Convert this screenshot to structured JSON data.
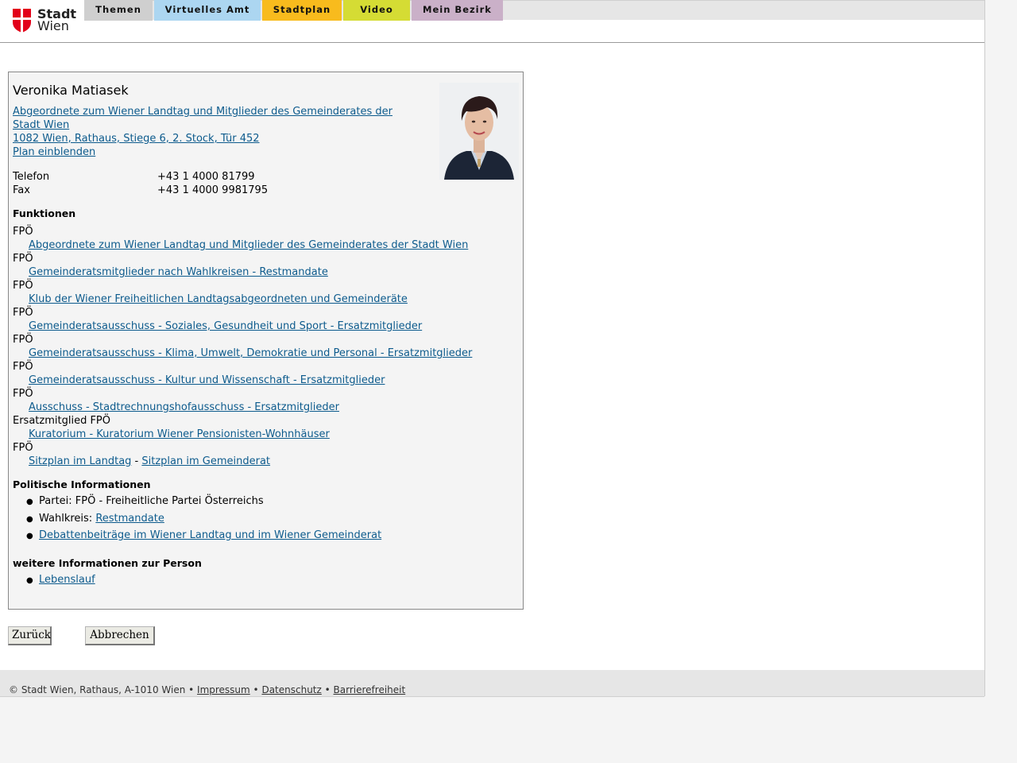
{
  "logo": {
    "line1": "Stadt",
    "line2": "Wien"
  },
  "nav": {
    "tabs": [
      {
        "label": "Themen",
        "color": "#cfcfcf"
      },
      {
        "label": "Virtuelles Amt",
        "color": "#acd6f1"
      },
      {
        "label": "Stadtplan",
        "color": "#f8bb1d"
      },
      {
        "label": "Video",
        "color": "#d5dc34"
      },
      {
        "label": "Mein Bezirk",
        "color": "#cab0c8"
      }
    ]
  },
  "person": {
    "name": "Veronika Matiasek",
    "role_line1": "Abgeordnete zum Wiener Landtag und Mitglieder des Gemeinderates der",
    "role_line2": "Stadt Wien ",
    "address": "1082 Wien, Rathaus, Stiege 6, 2. Stock, Tür 452",
    "plan_link": "Plan einblenden",
    "phone_label": "Telefon",
    "phone": "+43 1 4000 81799",
    "fax_label": "Fax",
    "fax": "+43 1 4000 9981795"
  },
  "functions": {
    "heading": "Funktionen",
    "items": [
      {
        "party": "FPÖ",
        "link": "Abgeordnete zum Wiener Landtag und Mitglieder des Gemeinderates der Stadt Wien"
      },
      {
        "party": "FPÖ",
        "link": "Gemeinderatsmitglieder nach Wahlkreisen - Restmandate"
      },
      {
        "party": "FPÖ",
        "link": "Klub der Wiener Freiheitlichen Landtagsabgeordneten und Gemeinderäte"
      },
      {
        "party": "FPÖ",
        "link": "Gemeinderatsausschuss - Soziales, Gesundheit und Sport - Ersatzmitglieder"
      },
      {
        "party": "FPÖ",
        "link": "Gemeinderatsausschuss - Klima, Umwelt, Demokratie und Personal - Ersatzmitglieder"
      },
      {
        "party": "FPÖ",
        "link": "Gemeinderatsausschuss - Kultur und Wissenschaft - Ersatzmitglieder"
      },
      {
        "party": "FPÖ",
        "link": "Ausschuss - Stadtrechnungshofausschuss - Ersatzmitglieder"
      },
      {
        "party": "Ersatzmitglied FPÖ",
        "link": "Kuratorium - Kuratorium Wiener Pensionisten-Wohnhäuser"
      }
    ],
    "last_party": "FPÖ",
    "seat_landtag": "Sitzplan im Landtag",
    "seat_sep": " - ",
    "seat_gemeinderat": "Sitzplan im Gemeinderat"
  },
  "political": {
    "heading": "Politische Informationen",
    "party_text": "Partei: FPÖ - Freiheitliche Partei Österreichs",
    "wahlkreis_label": "Wahlkreis: ",
    "wahlkreis_link": "Restmandate",
    "debate_link": "Debattenbeiträge im Wiener Landtag und im Wiener Gemeinderat"
  },
  "more": {
    "heading": "weitere Informationen zur Person",
    "cv_link": "Lebenslauf"
  },
  "buttons": {
    "back": "Zurück",
    "cancel": "Abbrechen"
  },
  "footer": {
    "copyright": "© Stadt Wien, Rathaus, A-1010 Wien",
    "sep": " • ",
    "impressum": "Impressum",
    "datenschutz": "Datenschutz",
    "barrierefreiheit": "Barrierefreiheit"
  }
}
